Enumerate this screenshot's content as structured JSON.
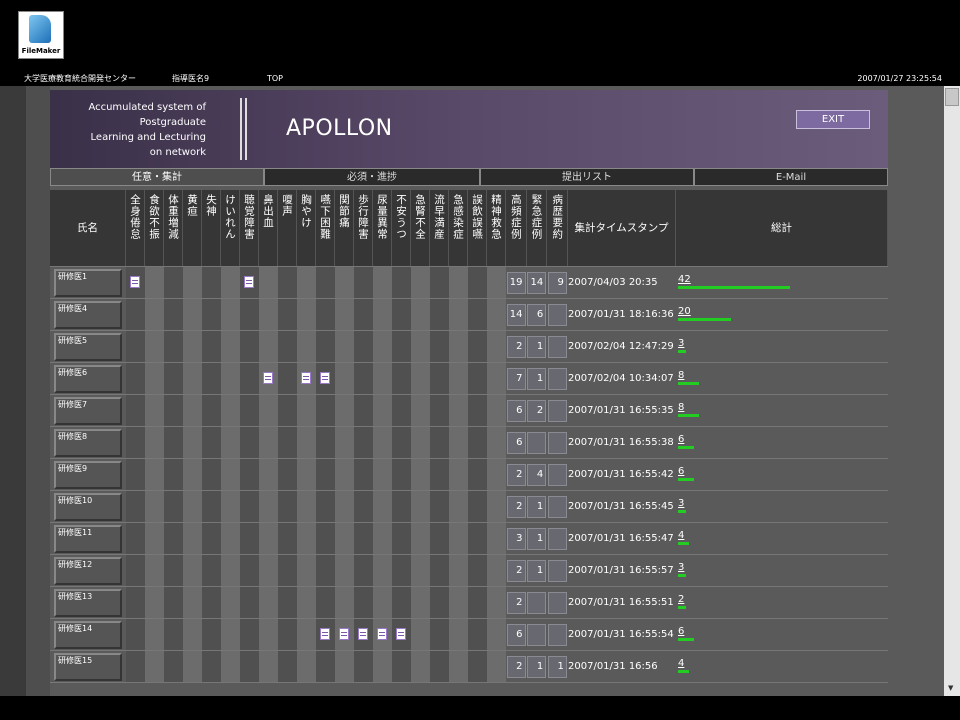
{
  "app": {
    "logo_text": "FileMaker"
  },
  "topbar": {
    "center": "大学医療教育統合開発センター",
    "tutor": "指導医名9",
    "top_link": "TOP",
    "timestamp": "2007/01/27 23:25:54"
  },
  "header": {
    "subtitle_lines": [
      "Accumulated system of",
      "Postgraduate",
      "Learning and Lecturing",
      "on network"
    ],
    "title": "APOLLON",
    "exit_label": "EXIT"
  },
  "tabs": [
    {
      "label": "任意・集計",
      "active": true
    },
    {
      "label": "必須・進捗",
      "active": false
    },
    {
      "label": "提出リスト",
      "active": false
    },
    {
      "label": "E-Mail",
      "active": false
    }
  ],
  "table": {
    "name_header": "氏名",
    "symptom_headers": [
      "全身倦怠",
      "食欲不振",
      "体重増減",
      "黄疸",
      "失神",
      "けいれん",
      "聴覚障害",
      "鼻出血",
      "嗄声",
      "胸やけ",
      "嚥下困難",
      "関節痛",
      "歩行障害",
      "尿量異常",
      "不安うつ",
      "急腎不全",
      "流早満産",
      "急感染症",
      "誤飲誤嚥",
      "精神救急"
    ],
    "count_headers": [
      "高頻症例",
      "緊急症例",
      "病歴要約"
    ],
    "stamp_header": "集計タイムスタンプ",
    "total_header": "総計",
    "bar_color": "#22cc22",
    "rows": [
      {
        "name": "研修医1",
        "memos": [
          0,
          6
        ],
        "counts": [
          "19",
          "14",
          "9"
        ],
        "stamp": "2007/04/03 20:35",
        "total": "42",
        "total_value": 42
      },
      {
        "name": "研修医4",
        "memos": [],
        "counts": [
          "14",
          "6",
          ""
        ],
        "stamp": "2007/01/31 18:16:36",
        "total": "20",
        "total_value": 20
      },
      {
        "name": "研修医5",
        "memos": [],
        "counts": [
          "2",
          "1",
          ""
        ],
        "stamp": "2007/02/04 12:47:29",
        "total": "3",
        "total_value": 3
      },
      {
        "name": "研修医6",
        "memos": [
          7,
          9,
          10
        ],
        "counts": [
          "7",
          "1",
          ""
        ],
        "stamp": "2007/02/04 10:34:07",
        "total": "8",
        "total_value": 8
      },
      {
        "name": "研修医7",
        "memos": [],
        "counts": [
          "6",
          "2",
          ""
        ],
        "stamp": "2007/01/31 16:55:35",
        "total": "8",
        "total_value": 8
      },
      {
        "name": "研修医8",
        "memos": [],
        "counts": [
          "6",
          "",
          ""
        ],
        "stamp": "2007/01/31 16:55:38",
        "total": "6",
        "total_value": 6
      },
      {
        "name": "研修医9",
        "memos": [],
        "counts": [
          "2",
          "4",
          ""
        ],
        "stamp": "2007/01/31 16:55:42",
        "total": "6",
        "total_value": 6
      },
      {
        "name": "研修医10",
        "memos": [],
        "counts": [
          "2",
          "1",
          ""
        ],
        "stamp": "2007/01/31 16:55:45",
        "total": "3",
        "total_value": 3
      },
      {
        "name": "研修医11",
        "memos": [],
        "counts": [
          "3",
          "1",
          ""
        ],
        "stamp": "2007/01/31 16:55:47",
        "total": "4",
        "total_value": 4
      },
      {
        "name": "研修医12",
        "memos": [],
        "counts": [
          "2",
          "1",
          ""
        ],
        "stamp": "2007/01/31 16:55:57",
        "total": "3",
        "total_value": 3
      },
      {
        "name": "研修医13",
        "memos": [],
        "counts": [
          "2",
          "",
          ""
        ],
        "stamp": "2007/01/31 16:55:51",
        "total": "2",
        "total_value": 2
      },
      {
        "name": "研修医14",
        "memos": [
          10,
          11,
          12,
          13,
          14
        ],
        "counts": [
          "6",
          "",
          ""
        ],
        "stamp": "2007/01/31 16:55:54",
        "total": "6",
        "total_value": 6
      },
      {
        "name": "研修医15",
        "memos": [],
        "counts": [
          "2",
          "1",
          "1"
        ],
        "stamp": "2007/01/31 16:56",
        "total": "4",
        "total_value": 4
      }
    ]
  }
}
